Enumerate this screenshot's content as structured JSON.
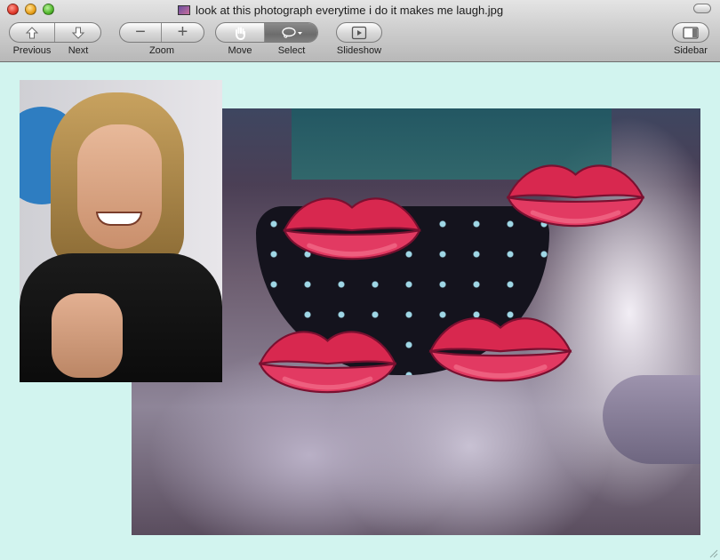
{
  "window": {
    "title": "look at this photograph everytime i do it makes me laugh.jpg"
  },
  "toolbar": {
    "nav": {
      "previous_label": "Previous",
      "next_label": "Next"
    },
    "zoom": {
      "label": "Zoom",
      "out_glyph": "−",
      "in_glyph": "+"
    },
    "tool": {
      "move_label": "Move",
      "select_label": "Select",
      "active": "select"
    },
    "slideshow_label": "Slideshow",
    "sidebar_label": "Sidebar"
  },
  "icons": {
    "previous": "arrow-up-icon",
    "next": "arrow-down-icon",
    "zoom_out": "minus-icon",
    "zoom_in": "plus-icon",
    "move": "hand-icon",
    "select": "lasso-icon",
    "slideshow": "play-icon",
    "sidebar": "sidebar-icon"
  },
  "colors": {
    "canvas_background": "#d2f4ef",
    "lip_red": "#d8284f",
    "lip_highlight": "#f46f8c"
  }
}
